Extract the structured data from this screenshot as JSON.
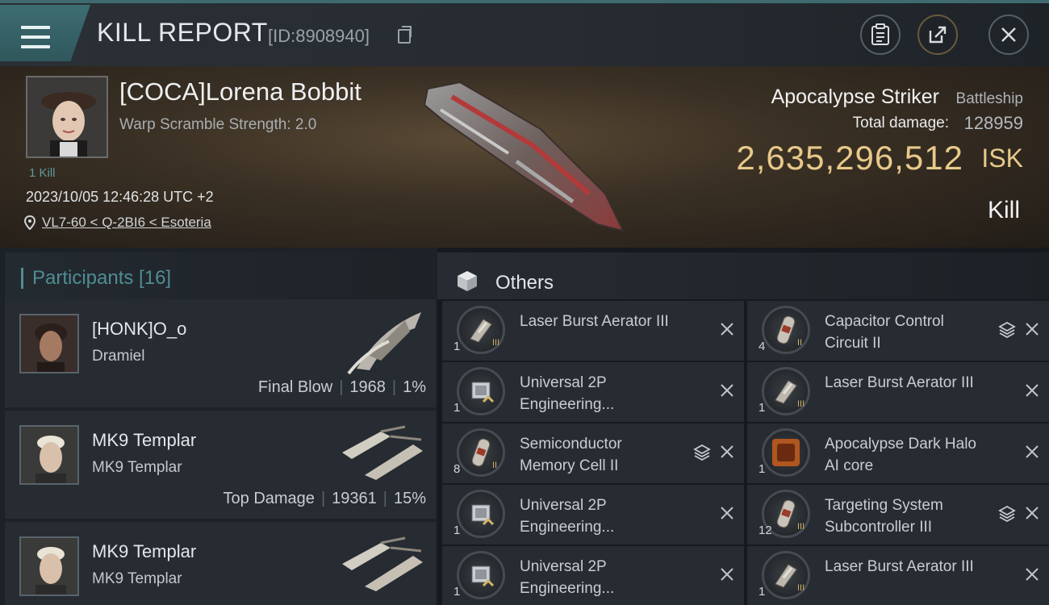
{
  "header": {
    "title": "KILL REPORT",
    "report_id": "[ID:8908940]"
  },
  "victim": {
    "name": "[COCA]Lorena Bobbit",
    "warp_scramble": "Warp Scramble Strength: 2.0",
    "kills": "1 Kill",
    "datetime": "2023/10/05 12:46:28 UTC +2",
    "location": "VL7-60 < Q-2BI6 < Esoteria",
    "ship_name": "Apocalypse Striker",
    "ship_class": "Battleship",
    "total_damage_label": "Total damage:",
    "total_damage": "128959",
    "isk_value": "2,635,296,512",
    "isk_unit": "ISK",
    "report_type": "Kill"
  },
  "participants": {
    "title": "Participants [16]",
    "rows": [
      {
        "name": "[HONK]O_o",
        "ship": "Dramiel",
        "role": "Final Blow",
        "damage": "1968",
        "percent": "1%"
      },
      {
        "name": "MK9 Templar",
        "ship": "MK9 Templar",
        "role": "Top Damage",
        "damage": "19361",
        "percent": "15%"
      },
      {
        "name": "MK9 Templar",
        "ship": "MK9 Templar",
        "role": "",
        "damage": "",
        "percent": ""
      }
    ]
  },
  "others": {
    "title": "Others",
    "items": [
      {
        "name": "Laser Burst Aerator III",
        "qty": "1",
        "meta": "III",
        "stack": false,
        "type": "module"
      },
      {
        "name": "Capacitor Control Circuit II",
        "qty": "4",
        "meta": "II",
        "stack": true,
        "type": "rig"
      },
      {
        "name": "Universal 2P Engineering...",
        "qty": "1",
        "meta": "",
        "stack": false,
        "type": "chip"
      },
      {
        "name": "Laser Burst Aerator III",
        "qty": "1",
        "meta": "III",
        "stack": false,
        "type": "module"
      },
      {
        "name": "Semiconductor Memory Cell II",
        "qty": "8",
        "meta": "II",
        "stack": true,
        "type": "rig"
      },
      {
        "name": "Apocalypse Dark Halo AI core",
        "qty": "1",
        "meta": "",
        "stack": false,
        "type": "core"
      },
      {
        "name": "Universal 2P Engineering...",
        "qty": "1",
        "meta": "",
        "stack": false,
        "type": "chip"
      },
      {
        "name": "Targeting System Subcontroller III",
        "qty": "12",
        "meta": "III",
        "stack": true,
        "type": "rig"
      },
      {
        "name": "Universal 2P Engineering...",
        "qty": "1",
        "meta": "",
        "stack": false,
        "type": "chip"
      },
      {
        "name": "Laser Burst Aerator III",
        "qty": "1",
        "meta": "III",
        "stack": false,
        "type": "module"
      }
    ]
  },
  "colors": {
    "accent_teal": "#4f8d92",
    "isk_gold": "#e8c98a",
    "meta_gold": "#d5b36a"
  }
}
